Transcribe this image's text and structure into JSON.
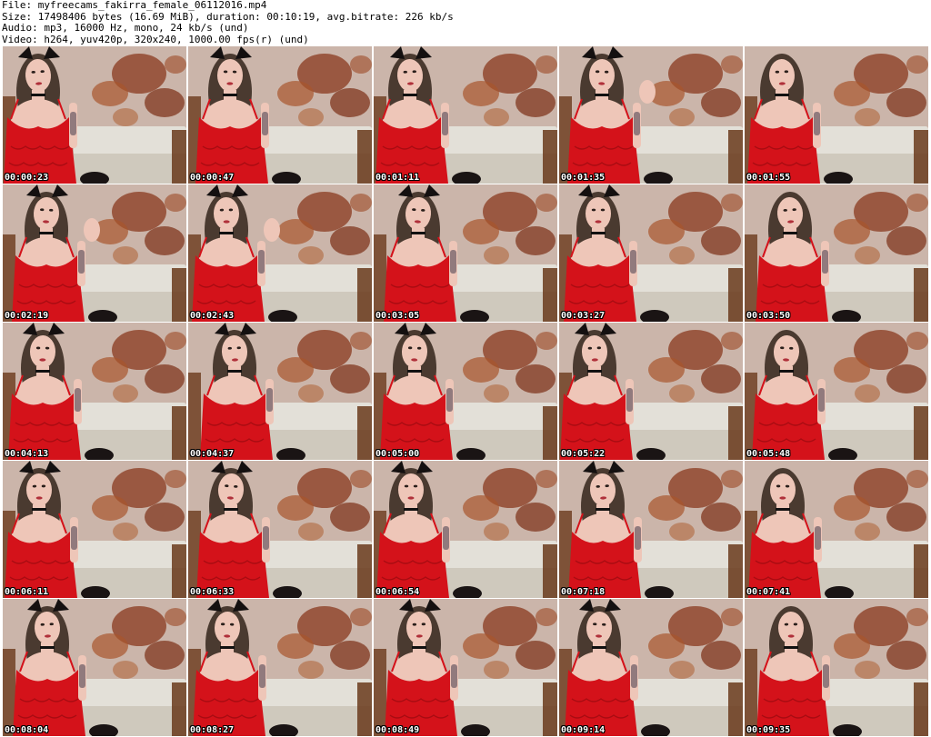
{
  "header": {
    "file_line": "File: myfreecams_fakirra_female_06112016.mp4",
    "size_line": "Size: 17498406 bytes (16.69 MiB), duration: 00:10:19, avg.bitrate: 226 kb/s",
    "audio_line": "Audio: mp3, 16000 Hz, mono, 24 kb/s (und)",
    "video_line": "Video: h264, yuv420p, 320x240, 1000.00 fps(r) (und)"
  },
  "thumbnails": [
    {
      "timestamp": "00:00:23"
    },
    {
      "timestamp": "00:00:47"
    },
    {
      "timestamp": "00:01:11"
    },
    {
      "timestamp": "00:01:35"
    },
    {
      "timestamp": "00:01:55"
    },
    {
      "timestamp": "00:02:19"
    },
    {
      "timestamp": "00:02:43"
    },
    {
      "timestamp": "00:03:05"
    },
    {
      "timestamp": "00:03:27"
    },
    {
      "timestamp": "00:03:50"
    },
    {
      "timestamp": "00:04:13"
    },
    {
      "timestamp": "00:04:37"
    },
    {
      "timestamp": "00:05:00"
    },
    {
      "timestamp": "00:05:22"
    },
    {
      "timestamp": "00:05:48"
    },
    {
      "timestamp": "00:06:11"
    },
    {
      "timestamp": "00:06:33"
    },
    {
      "timestamp": "00:06:54"
    },
    {
      "timestamp": "00:07:18"
    },
    {
      "timestamp": "00:07:41"
    },
    {
      "timestamp": "00:08:04"
    },
    {
      "timestamp": "00:08:27"
    },
    {
      "timestamp": "00:08:49"
    },
    {
      "timestamp": "00:09:14"
    },
    {
      "timestamp": "00:09:35"
    }
  ],
  "colors": {
    "dress": "#d4121a",
    "wall": "#cbb5aa",
    "flowers": "#8a3a1e",
    "sofa": "#e3e0d8",
    "hair": "#4a3a30",
    "skin": "#eec6b8",
    "wood": "#6a3a1c"
  }
}
